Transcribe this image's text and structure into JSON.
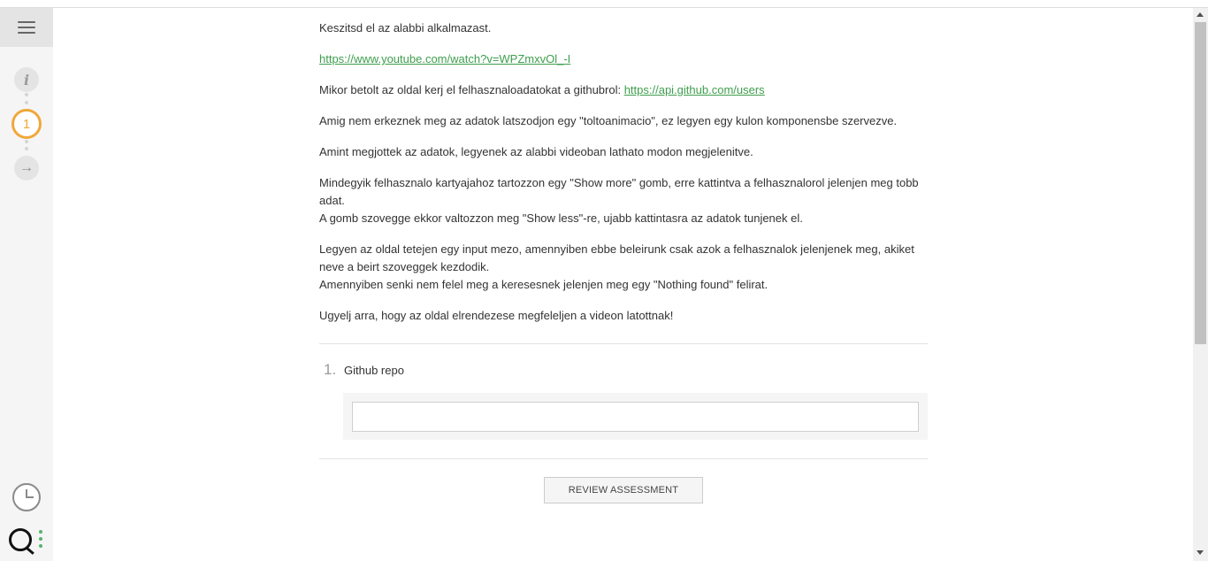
{
  "sidebar": {
    "menu_icon": "hamburger-icon",
    "steps": [
      {
        "icon": "info-icon",
        "label": "i"
      },
      {
        "icon": "step-number",
        "label": "1"
      },
      {
        "icon": "arrow-right-icon",
        "label": "→"
      }
    ],
    "bottom_icons": [
      "clock-icon",
      "logo"
    ]
  },
  "task": {
    "line1": "Keszitsd el az alabbi alkalmazast.",
    "video_link": "https://www.youtube.com/watch?v=WPZmxvOl_-I",
    "line3_text": "Mikor betolt az oldal kerj el felhasznaloadatokat a githubrol: ",
    "api_link": "https://api.github.com/users",
    "line4": "Amig nem erkeznek meg az adatok latszodjon egy \"toltoanimacio\", ez legyen egy kulon komponensbe szervezve.",
    "line5": "Amint megjottek az adatok, legyenek az alabbi videoban lathato modon megjelenitve.",
    "line6a": "Mindegyik felhasznalo kartyajahoz tartozzon egy \"Show more\" gomb, erre kattintva a felhasznalorol jelenjen meg tobb adat.",
    "line6b": "A gomb szovegge ekkor valtozzon meg \"Show less\"-re, ujabb kattintasra az adatok tunjenek el.",
    "line7a": "Legyen az oldal tetejen egy input mezo, amennyiben ebbe beleirunk csak azok a felhasznalok jelenjenek meg, akiket neve a beirt szoveggek kezdodik.",
    "line7b": "Amennyiben senki nem felel meg a keresesnek jelenjen meg egy \"Nothing found\" felirat.",
    "line8": "Ugyelj arra, hogy az oldal elrendezese megfeleljen a videon latottnak!"
  },
  "question": {
    "number": "1.",
    "label": "Github repo",
    "answer_value": ""
  },
  "review_button": "REVIEW ASSESSMENT",
  "colors": {
    "accent_orange": "#f0a83a",
    "link_green": "#3e9e4d",
    "logo_green": "#55b36b"
  }
}
